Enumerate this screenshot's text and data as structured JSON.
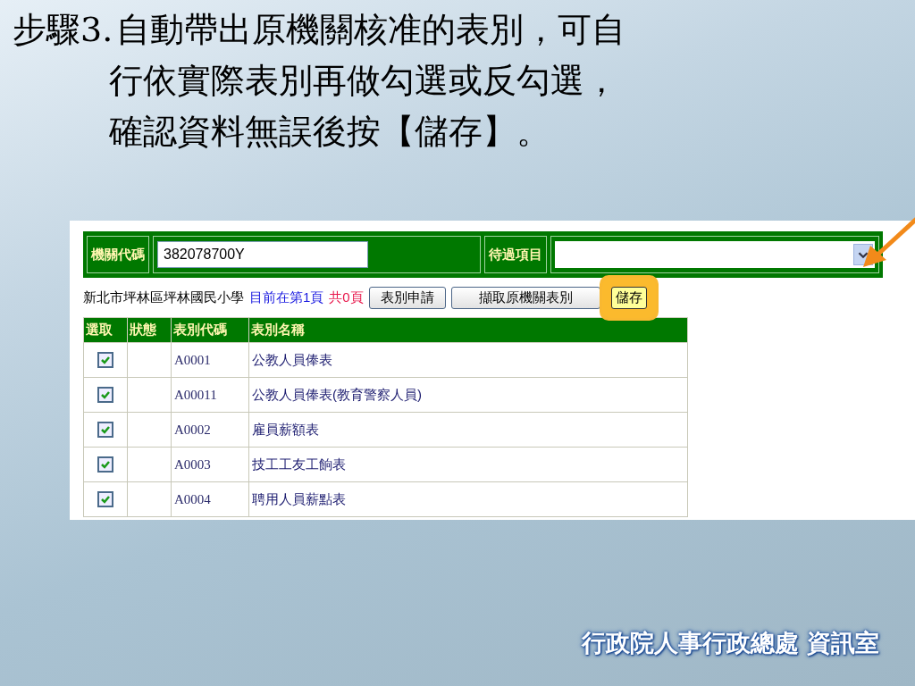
{
  "slide": {
    "step_label": "步驟3.",
    "lines": [
      "自動帶出原機關核准的表別，可自",
      "行依實際表別再做勾選或反勾選，",
      "確認資料無誤後按【儲存】。"
    ]
  },
  "form": {
    "org_code_label": "機關代碼",
    "org_code_value": "382078700Y",
    "pending_label": "待過項目"
  },
  "info": {
    "org_name": "新北市坪林區坪林國民小學",
    "current_page": "目前在第1頁",
    "total_pages": "共0頁"
  },
  "buttons": [
    {
      "label": "表別申請",
      "highlighted": false
    },
    {
      "label": "擷取原機關表別",
      "highlighted": false
    },
    {
      "label": "儲存",
      "highlighted": true
    }
  ],
  "table": {
    "columns": [
      "選取",
      "狀態",
      "表別代碼",
      "表別名稱"
    ],
    "rows": [
      {
        "checked": true,
        "code": "A0001",
        "name": "公教人員俸表"
      },
      {
        "checked": true,
        "code": "A00011",
        "name": "公教人員俸表(教育警察人員)"
      },
      {
        "checked": true,
        "code": "A0002",
        "name": "雇員薪額表"
      },
      {
        "checked": true,
        "code": "A0003",
        "name": "技工工友工餉表"
      },
      {
        "checked": true,
        "code": "A0004",
        "name": "聘用人員薪點表"
      }
    ]
  },
  "footer": {
    "text": "行政院人事行政總處 資訊室"
  }
}
